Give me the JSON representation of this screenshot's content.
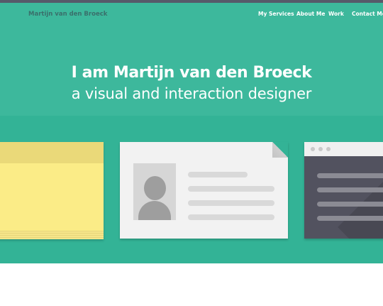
{
  "header": {
    "brand": "Martijn van den Broeck",
    "nav": [
      "My Services",
      "About Me",
      "Work",
      "Contact Me"
    ]
  },
  "hero": {
    "title": "I am Martijn van den Broeck",
    "subtitle": "a visual and interaction designer"
  },
  "colors": {
    "hero_bg": "#3db89c",
    "band_bg": "#33b396",
    "topbar": "#56596a",
    "sticky_note": "#fbec87",
    "browser_dark": "#52525f"
  },
  "illustrations": [
    "sticky-note",
    "profile-card",
    "browser-window"
  ]
}
